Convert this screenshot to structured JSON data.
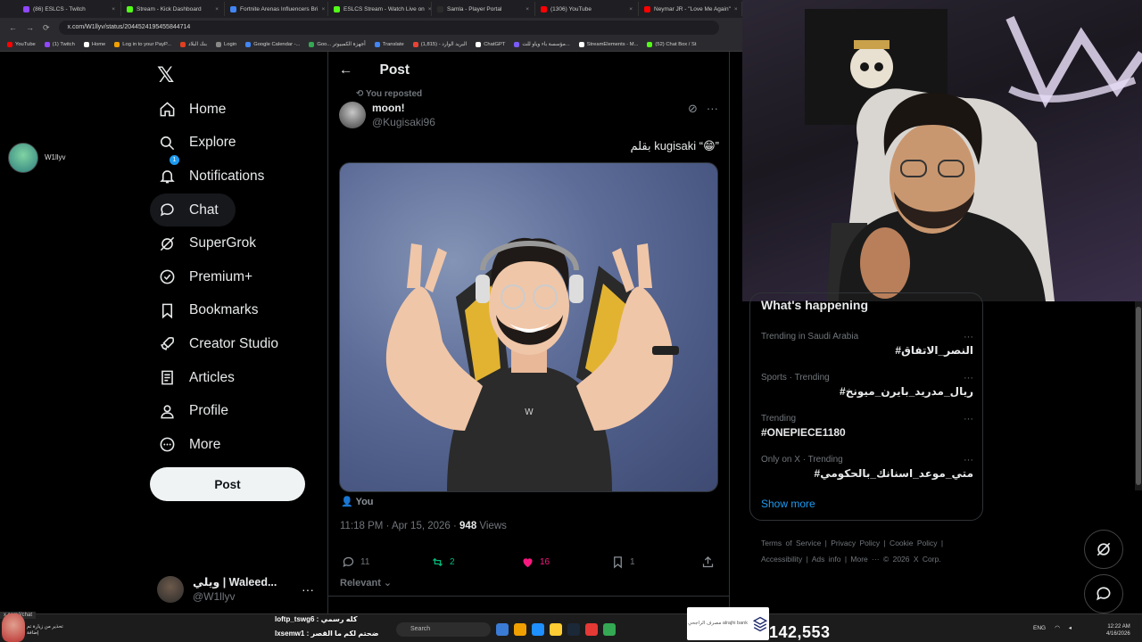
{
  "browser": {
    "tabs": [
      {
        "label": "(86) ESLCS - Twitch",
        "color": "#9146ff"
      },
      {
        "label": "Stream - Kick Dashboard",
        "color": "#53fc18"
      },
      {
        "label": "Fortnite Arenas Influencers Bri",
        "color": "#4285f4"
      },
      {
        "label": "ESLCS Stream - Watch Live on",
        "color": "#53fc18"
      },
      {
        "label": "Samla - Player Portal",
        "color": "#2b2b2b"
      },
      {
        "label": "(1306) YouTube",
        "color": "#ff0000"
      },
      {
        "label": "Neymar JR - \"Love Me Again\"",
        "color": "#ff0000"
      }
    ],
    "url": "x.com/W1llyv/status/2044524195455844714",
    "bookmarks": [
      {
        "label": "YouTube",
        "color": "#ff0000"
      },
      {
        "label": "(1) Twitch",
        "color": "#9146ff"
      },
      {
        "label": "Home",
        "color": "#ffffff"
      },
      {
        "label": "Log in to your PayP...",
        "color": "#f0a000"
      },
      {
        "label": "بنك البلاد",
        "color": "#e04020"
      },
      {
        "label": "Login",
        "color": "#888888"
      },
      {
        "label": "Google Calendar -...",
        "color": "#4285f4"
      },
      {
        "label": "Goo... أجهزة الكمبيوتر",
        "color": "#34a853"
      },
      {
        "label": "Translate",
        "color": "#4285f4"
      },
      {
        "label": "البريد الوارد - (1,815)",
        "color": "#ea4335"
      },
      {
        "label": "ChatGPT",
        "color": "#ffffff"
      },
      {
        "label": "مؤسسة باء وياو للت...",
        "color": "#7a5af8"
      },
      {
        "label": "StreamElements - M...",
        "color": "#ffffff"
      },
      {
        "label": "(52) Chat Box / St",
        "color": "#53fc18"
      }
    ]
  },
  "sidebar": {
    "profile_name": "W1llyv",
    "nav": [
      {
        "label": "Home",
        "icon": "home-icon"
      },
      {
        "label": "Explore",
        "icon": "search-icon"
      },
      {
        "label": "Notifications",
        "icon": "bell-icon",
        "badge": "1"
      },
      {
        "label": "Chat",
        "icon": "chat-icon",
        "active": true
      },
      {
        "label": "SuperGrok",
        "icon": "grok-icon"
      },
      {
        "label": "Premium+",
        "icon": "verified-icon"
      },
      {
        "label": "Bookmarks",
        "icon": "bookmark-icon"
      },
      {
        "label": "Creator Studio",
        "icon": "rocket-icon"
      },
      {
        "label": "Articles",
        "icon": "article-icon"
      },
      {
        "label": "Profile",
        "icon": "person-icon"
      },
      {
        "label": "More",
        "icon": "more-circle-icon"
      }
    ],
    "post_button": "Post",
    "account": {
      "name": "ويلي | Waleed...",
      "handle": "@W1llyv"
    }
  },
  "post": {
    "header": "Post",
    "repost_note": "You reposted",
    "author_name": "moon!",
    "author_handle": "@Kugisaki96",
    "text": "بقلم kugisaki “😁”",
    "tagged": "You",
    "time": "11:18 PM · Apr 15, 2026 · ",
    "views_count": "948",
    "views_label": " Views",
    "replies": "11",
    "reposts": "2",
    "likes": "16",
    "bookmarks": "1",
    "sort": "Relevant"
  },
  "trends": {
    "title": "What's happening",
    "items": [
      {
        "context": "Trending in Saudi Arabia",
        "tag": "#النصر_الاتفاق",
        "rtl": true
      },
      {
        "context": "Sports · Trending",
        "tag": "#ريال_مدريد_بايرن_ميونخ",
        "rtl": true
      },
      {
        "context": "Trending",
        "tag": "#ONEPIECE1180",
        "rtl": false
      },
      {
        "context": "Only on X · Trending",
        "tag": "#متي_موعد_اسنانك_بالحكومي",
        "rtl": true
      }
    ],
    "show_more": "Show more",
    "footer": "Terms of Service | Privacy Policy | Cookie Policy | Accessibility | Ads info | More ··· © 2026 X Corp."
  },
  "taskbar": {
    "search": "Search",
    "viewers": "142,553",
    "sponsor": "مصرف الراجحي alrajhi bank",
    "chat1": "loftp_tswg6 : كله رسمي",
    "chat2": "lxsemw1 : ضحتم لكم ما القصر",
    "status_url": "x.com/i/chat",
    "left_text": "تحذير من زيارة تم إضافة",
    "lang": "ENG",
    "time": "12:22 AM",
    "date": "4/16/2026"
  },
  "colors": {
    "accent": "#1d9bf0",
    "like": "#f91880",
    "repost": "#00ba7c",
    "background": "#000000"
  }
}
